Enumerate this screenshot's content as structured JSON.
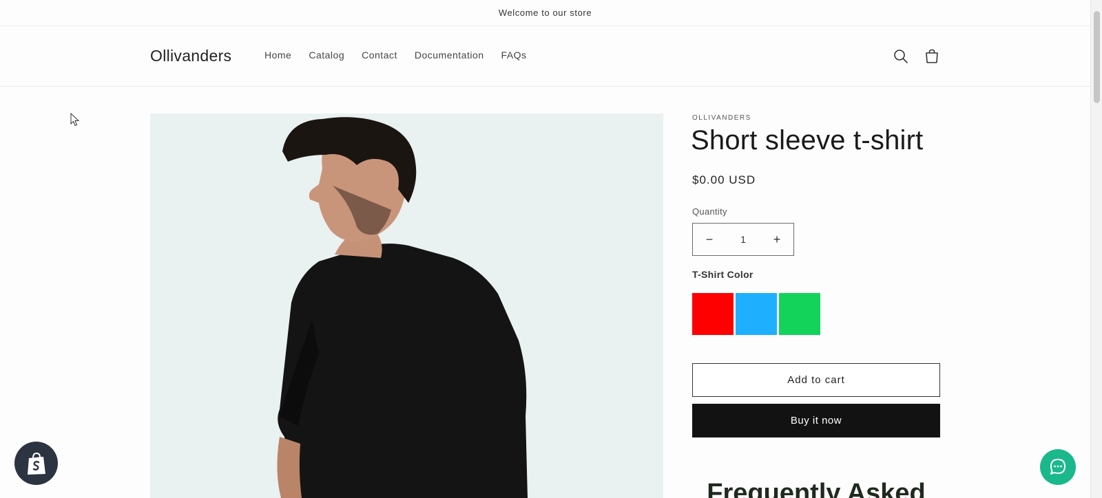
{
  "announcement": {
    "text": "Welcome to our store"
  },
  "header": {
    "logo": "Ollivanders",
    "nav": [
      "Home",
      "Catalog",
      "Contact",
      "Documentation",
      "FAQs"
    ],
    "search_icon": "search-icon",
    "cart_icon": "cart-icon"
  },
  "product": {
    "vendor": "OLLIVANDERS",
    "title": "Short sleeve t-shirt",
    "price": "$0.00 USD",
    "quantity_label": "Quantity",
    "quantity_value": "1",
    "decrease_symbol": "−",
    "increase_symbol": "+",
    "color_label": "T-Shirt Color",
    "swatches": [
      {
        "color": "#ff0000"
      },
      {
        "color": "#1eb0ff"
      },
      {
        "color": "#14d35a"
      }
    ],
    "add_to_cart_label": "Add to cart",
    "buy_now_label": "Buy it now"
  },
  "faq": {
    "heading": "Frequently Asked"
  },
  "colors": {
    "buy_now_bg": "#121212",
    "chat_bg": "#1bb88c",
    "shop_badge_bg": "#2c3341",
    "image_bg": "#e9f1f1"
  }
}
